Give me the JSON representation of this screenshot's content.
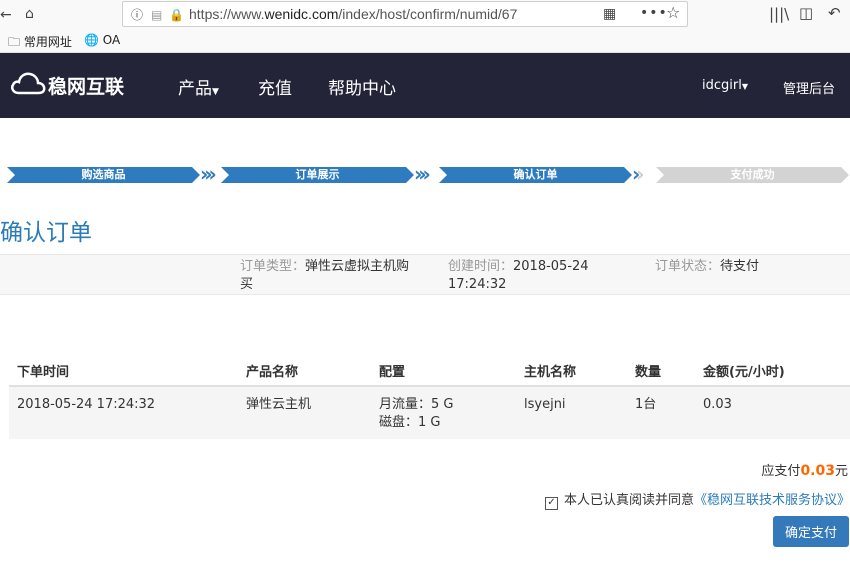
{
  "browser": {
    "url_prefix": "https://www.",
    "url_host": "wenidc.com",
    "url_path": "/index/host/confirm/numid/67",
    "bookmarks": [
      {
        "label": "常用网址",
        "icon": "folder-icon"
      },
      {
        "label": "OA",
        "icon": "globe-icon"
      }
    ]
  },
  "nav": {
    "logo_text": "稳网互联",
    "items": [
      "产品",
      "充值",
      "帮助中心"
    ],
    "user": "idcgirl",
    "admin": "管理后台"
  },
  "steps": [
    "购选商品",
    "订单展示",
    "确认订单",
    "支付成功"
  ],
  "page_title": "确认订单",
  "order_info": {
    "type_label": "订单类型：",
    "type_value_line1": "弹性云虚拟主机购",
    "type_value_line2": "买",
    "created_label": "创建时间：",
    "created_date": "2018-05-24",
    "created_time": "17:24:32",
    "status_label": "订单状态：",
    "status_value": "待支付"
  },
  "table": {
    "headers": [
      "下单时间",
      "产品名称",
      "配置",
      "主机名称",
      "数量",
      "金额(元/小时)"
    ],
    "rows": [
      {
        "time": "2018-05-24 17:24:32",
        "product": "弹性云主机",
        "config_line1": "月流量：5 G",
        "config_line2": "磁盘：1 G",
        "host": "lsyejni",
        "qty": "1台",
        "amount": "0.03"
      }
    ]
  },
  "total": {
    "label": "应支付",
    "amount": "0.03",
    "unit": "元"
  },
  "agreement": {
    "text": "本人已认真阅读并同意",
    "link": "《稳网互联技术服务协议》",
    "checked": true
  },
  "pay_button": "确定支付",
  "colors": {
    "navbar": "#232438",
    "accent": "#2b7bb9",
    "amount": "#ff6600"
  }
}
